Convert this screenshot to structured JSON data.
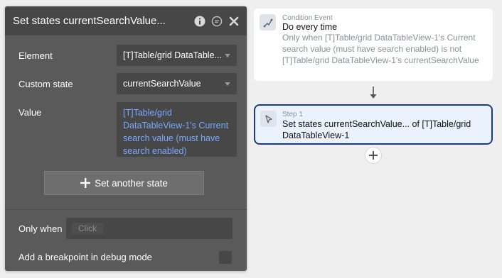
{
  "panel": {
    "title": "Set states currentSearchValue...",
    "header_icons": [
      "info-icon",
      "comment-icon",
      "close-icon"
    ],
    "element_label": "Element",
    "element_value": "[T]Table/grid DataTable...",
    "custom_state_label": "Custom state",
    "custom_state_value": "currentSearchValue",
    "value_label": "Value",
    "value_text": "[T]Table/grid DataTableView-1's Current search value (must have search enabled)",
    "set_another_state_label": "Set another state",
    "only_when_label": "Only when",
    "only_when_placeholder": "Click",
    "breakpoint_label": "Add a breakpoint in debug mode",
    "breakpoint_checked": false
  },
  "workflow": {
    "event": {
      "kicker": "Condition Event",
      "title": "Do every time",
      "description": "Only when [T]Table/grid DataTableView-1's Current search value (must have search enabled) is not [T]Table/grid DataTableView-1's currentSearchValue",
      "icon": "condition-icon"
    },
    "step": {
      "kicker": "Step 1",
      "title": "Set states currentSearchValue... of [T]Table/grid DataTableView-1",
      "icon": "cursor-icon"
    }
  },
  "colors": {
    "panel_bg": "#5a5a5a",
    "panel_header": "#474747",
    "field_bg": "#474747",
    "dynamic_value_blue": "#7aa9ff",
    "step_border": "#1b3a8a",
    "step_bg": "#eaf2fd"
  }
}
